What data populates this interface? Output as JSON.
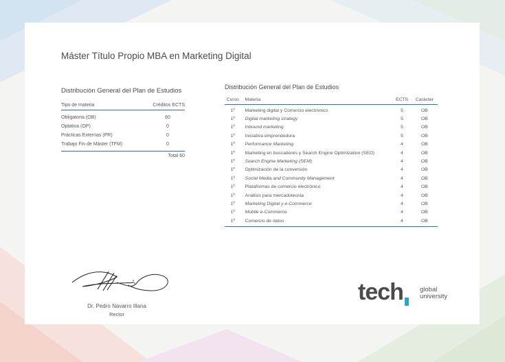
{
  "document": {
    "title": "Máster Título Propio MBA en Marketing Digital"
  },
  "summary": {
    "heading": "Distribución General del Plan de Estudios",
    "col_type": "Tipo de materia",
    "col_credits": "Créditos ECTS",
    "rows": [
      {
        "type": "Obligatoria (OB)",
        "credits": "60"
      },
      {
        "type": "Optativa (OP)",
        "credits": "0"
      },
      {
        "type": "Prácticas Externas (PR)",
        "credits": "0"
      },
      {
        "type": "Trabajo Fin de Máster (TFM)",
        "credits": "0"
      }
    ],
    "total": "Total 60"
  },
  "subjects": {
    "heading": "Distribución General del Plan de Estudios",
    "col_course": "Curso",
    "col_subject": "Materia",
    "col_ects": "ECTS",
    "col_type": "Carácter",
    "rows": [
      {
        "course": "1º",
        "subject": "Marketing digital y Comercio electrónico",
        "ects": "5",
        "type": "OB"
      },
      {
        "course": "1º",
        "subject": "Digital marketing strategy",
        "ects": "5",
        "type": "OB"
      },
      {
        "course": "1º",
        "subject": "Inbound marketing",
        "ects": "5",
        "type": "OB"
      },
      {
        "course": "1º",
        "subject": "Iniciativa emprendedora",
        "ects": "5",
        "type": "OB"
      },
      {
        "course": "1º",
        "subject": "Performance Marketing",
        "ects": "4",
        "type": "OB"
      },
      {
        "course": "1º",
        "subject": "Marketing en buscadores y Search Engine Optimization (SEO)",
        "ects": "4",
        "type": "OB"
      },
      {
        "course": "1º",
        "subject": "Search Engine Marketing (SEM)",
        "ects": "4",
        "type": "OB"
      },
      {
        "course": "1º",
        "subject": "Optimización de la conversión",
        "ects": "4",
        "type": "OB"
      },
      {
        "course": "1º",
        "subject": "Social Media and Community Management",
        "ects": "4",
        "type": "OB"
      },
      {
        "course": "1º",
        "subject": "Plataformas de comercio electrónico",
        "ects": "4",
        "type": "OB"
      },
      {
        "course": "1º",
        "subject": "Análisis para mercadotecnia",
        "ects": "4",
        "type": "OB"
      },
      {
        "course": "1º",
        "subject": "Marketing Digital y e-Commerce",
        "ects": "4",
        "type": "OB"
      },
      {
        "course": "1º",
        "subject": "Mobile e-Commerce",
        "ects": "4",
        "type": "OB"
      },
      {
        "course": "1º",
        "subject": "Comercio de datos",
        "ects": "4",
        "type": "OB"
      }
    ]
  },
  "signature": {
    "name": "Dr. Pedro Navarro Illana",
    "role": "Rector"
  },
  "logo": {
    "word": "tech",
    "line1": "global",
    "line2": "university",
    "accent": "#2aa6c9"
  },
  "colors": {
    "rule": "#2d6ea8"
  }
}
